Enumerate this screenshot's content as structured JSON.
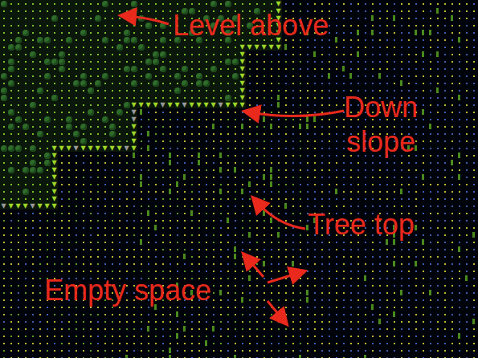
{
  "map": {
    "slope_glyph": "▼"
  },
  "labels": [
    {
      "lines": [
        "Level above"
      ]
    },
    {
      "lines": [
        "Down",
        "slope"
      ]
    },
    {
      "lines": [
        "Tree top"
      ]
    },
    {
      "lines": [
        "Empty space"
      ]
    }
  ],
  "label_color": "#e8291c"
}
